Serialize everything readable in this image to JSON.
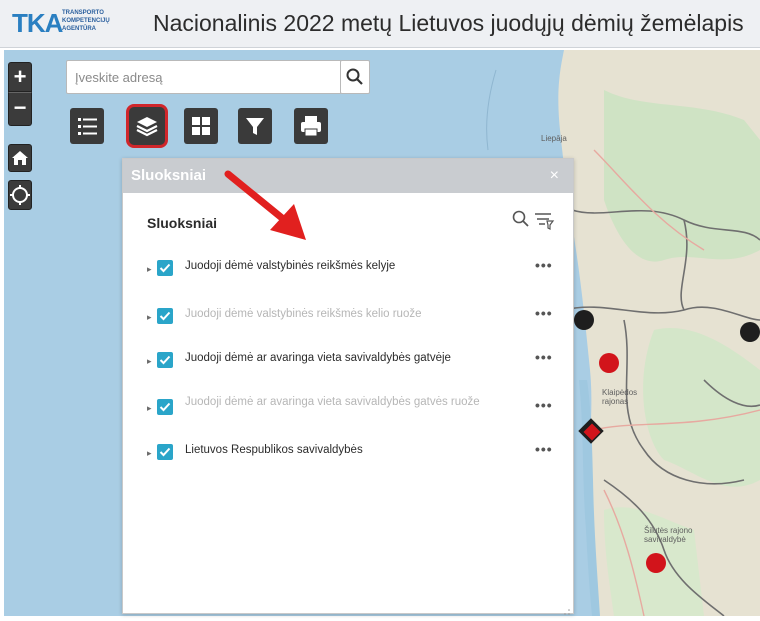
{
  "header": {
    "logo_text": "TKA",
    "logo_subtext": "TRANSPORTO KOMPETENCIJŲ AGENTŪRA",
    "title": "Nacionalinis 2022 metų Lietuvos juodųjų dėmių žemėlapis"
  },
  "map_controls": {
    "zoom_in": "+",
    "zoom_out": "−",
    "home_icon": "home-icon",
    "locate_icon": "locate-icon"
  },
  "search": {
    "placeholder": "Įveskite adresą",
    "value": ""
  },
  "toolbar": {
    "list_icon": "list-icon",
    "layers_icon": "layers-icon",
    "grid_icon": "grid-icon",
    "filter_icon": "filter-icon",
    "print_icon": "print-icon"
  },
  "panel": {
    "title": "Sluoksniai",
    "close": "×",
    "subtitle": "Sluoksniai",
    "layers": [
      {
        "label": "Juodoji dėmė valstybinės reikšmės kelyje",
        "checked": true,
        "dim": false
      },
      {
        "label": "Juodoji dėmė valstybinės reikšmės kelio ruože",
        "checked": true,
        "dim": true
      },
      {
        "label": "Juodoji dėmė ar avaringa vieta savivaldybės gatvėje",
        "checked": true,
        "dim": false
      },
      {
        "label": "Juodoji dėmė ar avaringa vieta savivaldybės gatvės ruože",
        "checked": true,
        "dim": true
      },
      {
        "label": "Lietuvos Respublikos savivaldybės",
        "checked": true,
        "dim": false
      }
    ],
    "more": "•••"
  },
  "map_labels": {
    "liepaja": "Liepāja",
    "klaipeda": "Klaipėdos rajonas",
    "silute": "Šilutės rajono savivaldybė"
  },
  "colors": {
    "accent": "#2aa5c9",
    "highlight_red": "#d0262b",
    "toolbar_dark": "#3a3a3a",
    "marker_red": "#d2141b",
    "marker_black": "#1e1e1e"
  }
}
